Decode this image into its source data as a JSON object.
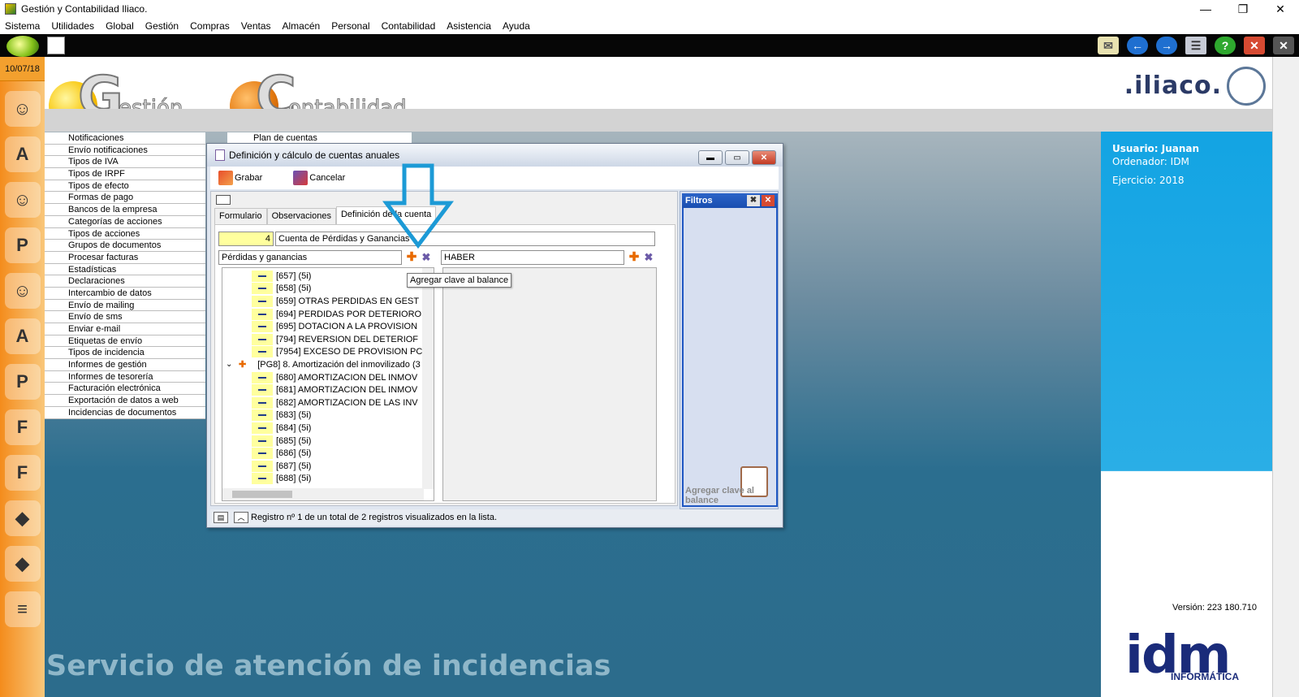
{
  "window": {
    "title": "Gestión y Contabilidad Iliaco.",
    "minimize": "—",
    "restore": "❐",
    "close": "✕"
  },
  "menubar": [
    "Sistema",
    "Utilidades",
    "Global",
    "Gestión",
    "Compras",
    "Ventas",
    "Almacén",
    "Personal",
    "Contabilidad",
    "Asistencia",
    "Ayuda"
  ],
  "sidebar": {
    "date": "10/07/18"
  },
  "header": {
    "logo_gestion_big": "G",
    "logo_gestion_small": "estión",
    "logo_contab_big": "C",
    "logo_contab_small": "ontabilidad",
    "brand": ".iliaco."
  },
  "left_menu": [
    "Notificaciones",
    "Envío notificaciones",
    "Tipos de IVA",
    "Tipos de IRPF",
    "Tipos de efecto",
    "Formas de pago",
    "Bancos de la empresa",
    "Categorías de acciones",
    "Tipos de acciones",
    "Grupos de documentos",
    "Procesar facturas",
    "Estadísticas",
    "Declaraciones",
    "Intercambio de datos",
    "Envío de mailing",
    "Envío de sms",
    "Enviar e-mail",
    "Etiquetas de envío",
    "Tipos de incidencia",
    "Informes de gestión",
    "Informes de tesorería",
    "Facturación electrónica",
    "Exportación de datos a web",
    "Incidencias de documentos"
  ],
  "plan_cuentas": "Plan de cuentas",
  "info_panel": {
    "usuario": "Usuario: Juanan",
    "ordenador": "Ordenador: IDM",
    "ejercicio": "Ejercicio: 2018",
    "version": "Versión: 223 180.710",
    "logo": "idm",
    "logo_sub": "INFORMÁTICA"
  },
  "service_text": "Servicio de atención de incidencias",
  "dialog": {
    "title": "Definición y cálculo de cuentas anuales",
    "toolbar": {
      "save": "Grabar",
      "cancel": "Cancelar"
    },
    "tabs": [
      "Formulario",
      "Observaciones",
      "Definición de la cuenta"
    ],
    "account_number": "4",
    "account_name": "Cuenta de Pérdidas y Ganancias",
    "left_header": "Pérdidas y ganancias",
    "right_header": "HABER",
    "tooltip": "Agregar clave al balance",
    "tree_items": [
      "[657] (5i)",
      "[658] (5i)",
      "[659] OTRAS PERDIDAS EN GEST",
      "[694] PERDIDAS POR DETERIORO",
      "[695] DOTACION A LA PROVISION",
      "[794] REVERSION DEL DETERIOF",
      "[7954] EXCESO DE PROVISION PC",
      "[PG8] 8. Amortización del inmovilizado (3",
      "[680] AMORTIZACION DEL INMOV",
      "[681] AMORTIZACION DEL INMOV",
      "[682] AMORTIZACION DE LAS INV",
      "[683] (5i)",
      "[684] (5i)",
      "[685] (5i)",
      "[686] (5i)",
      "[687] (5i)",
      "[688] (5i)"
    ],
    "filters": {
      "title": "Filtros",
      "hint": "Agregar clave al balance"
    },
    "status": "Registro nº 1 de un total de 2 registros visualizados en la lista."
  }
}
